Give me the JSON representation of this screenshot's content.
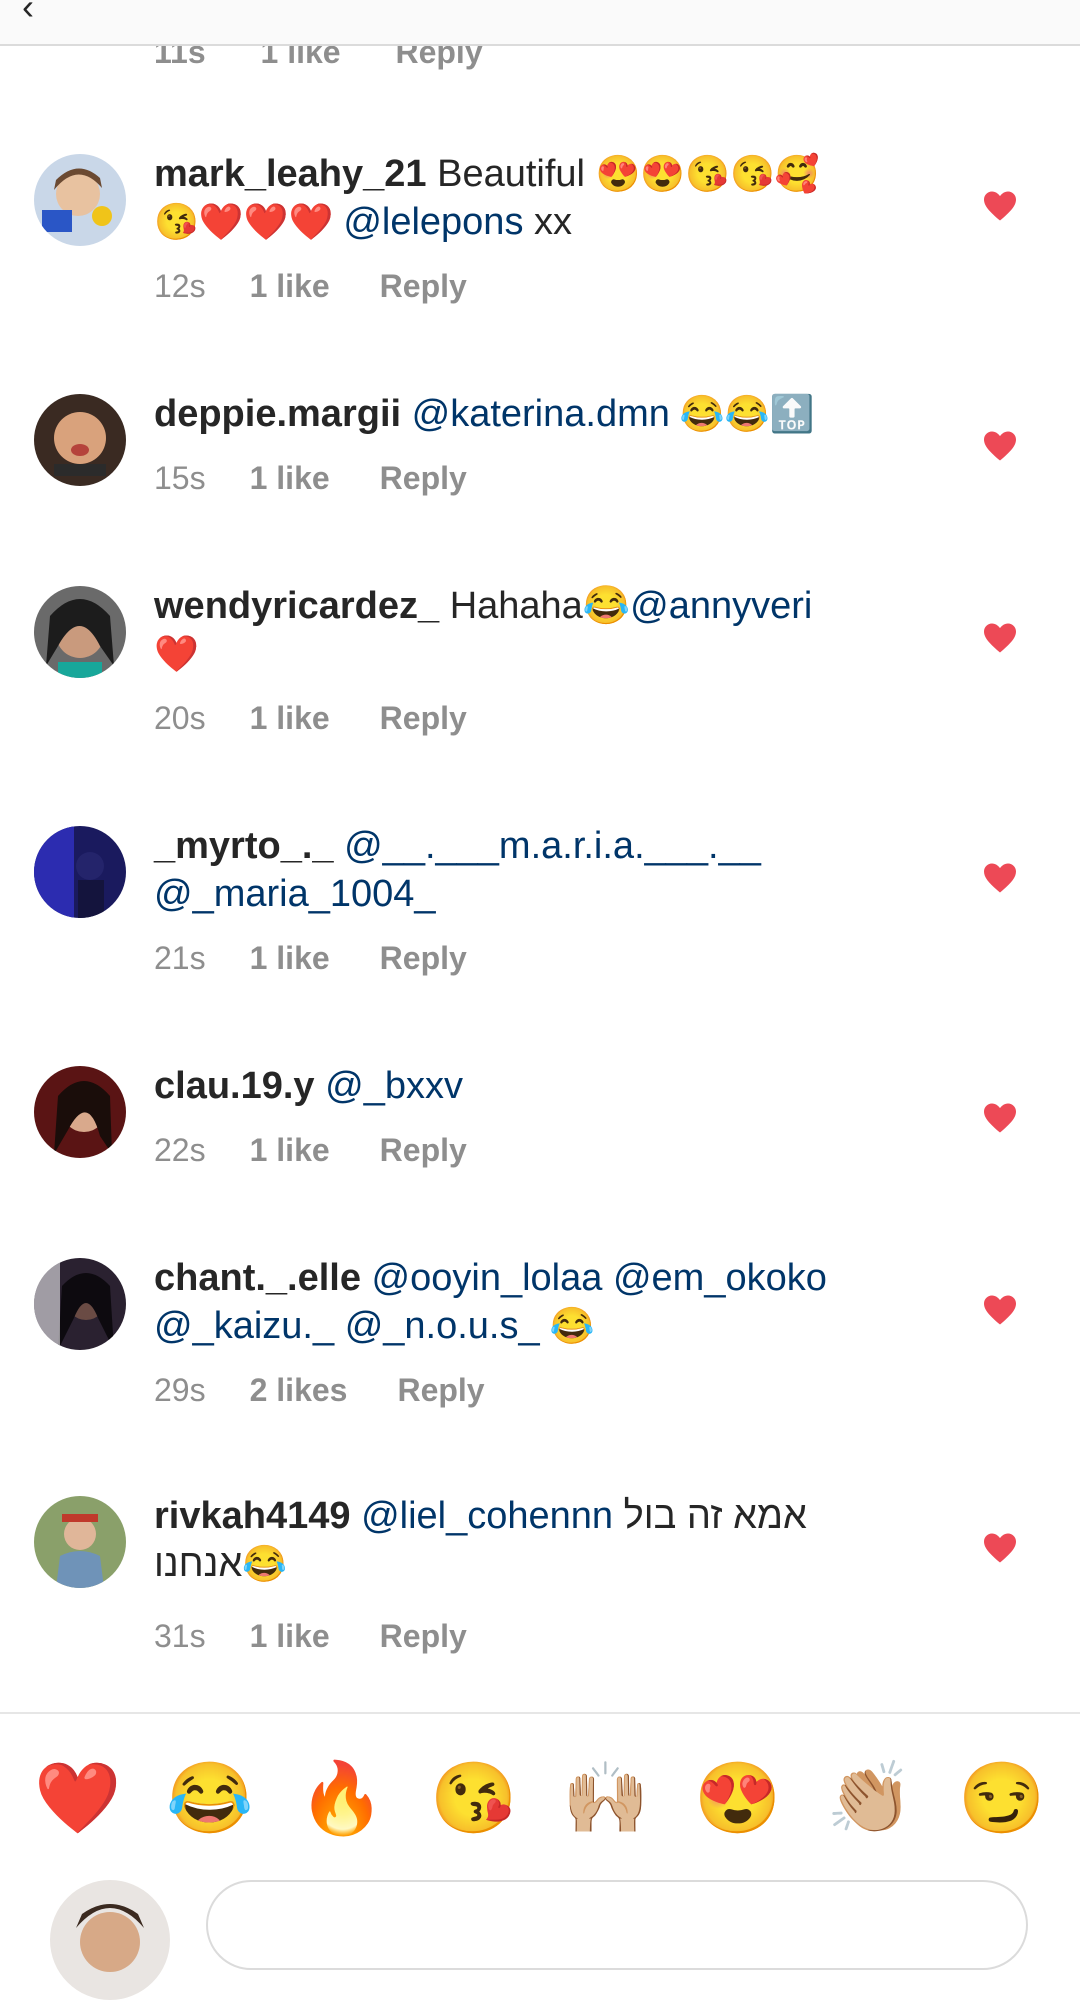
{
  "partial_comment": {
    "time": "11s",
    "likes": "1 like",
    "reply": "Reply"
  },
  "comments": [
    {
      "username": "mark_leahy_21",
      "text_before": " Beautiful ",
      "emoji_line1": "😍😍😘😘🥰",
      "emoji_line2": "😘❤️❤️❤️ ",
      "mention": "@lelepons",
      "text_after": " xx",
      "time": "12s",
      "likes": "1 like",
      "reply": "Reply"
    },
    {
      "username": "deppie.margii",
      "mention": "@katerina.dmn",
      "emoji": " 😂😂🔝",
      "time": "15s",
      "likes": "1 like",
      "reply": "Reply"
    },
    {
      "username": "wendyricardez_",
      "text": " Hahaha😂",
      "mention": "@annyveri",
      "emoji_line2": "❤️",
      "time": "20s",
      "likes": "1 like",
      "reply": "Reply"
    },
    {
      "username": "_myrto_._",
      "mention1": "@__.___m.a.r.i.a.___.__",
      "mention2": "@_maria_1004_",
      "time": "21s",
      "likes": "1 like",
      "reply": "Reply"
    },
    {
      "username": "clau.19.y",
      "mention": "@_bxxv",
      "time": "22s",
      "likes": "1 like",
      "reply": "Reply"
    },
    {
      "username": "chant._.elle",
      "mention1": "@ooyin_lolaa",
      "mention2": "@em_okoko",
      "mention3": "@_kaizu._",
      "mention4": "@_n.o.u.s_",
      "emoji": " 😂",
      "time": "29s",
      "likes": "2 likes",
      "reply": "Reply"
    },
    {
      "username": "rivkah4149",
      "mention": "@liel_cohennn",
      "hebrew1": "אמא זה בול",
      "hebrew2": "אנחנו",
      "emoji": "😂",
      "time": "31s",
      "likes": "1 like",
      "reply": "Reply"
    }
  ],
  "quick_reactions": [
    "❤️",
    "😂",
    "🔥",
    "😘",
    "🙌🏼",
    "😍",
    "👏🏼",
    "😏"
  ],
  "colors": {
    "heart": "#ed4956",
    "mention": "#003569",
    "meta": "#8e8e8e"
  }
}
